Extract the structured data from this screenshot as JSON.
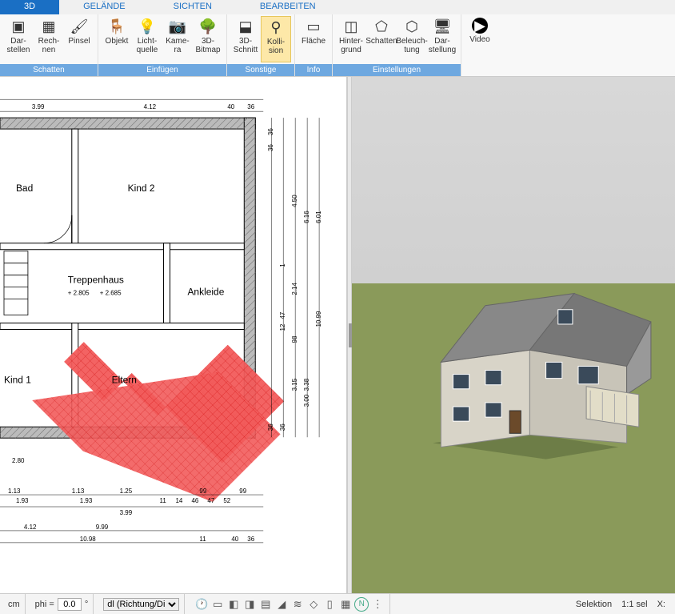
{
  "tabs": {
    "t0": "3D",
    "t1": "GELÄNDE",
    "t2": "SICHTEN",
    "t3": "BEARBEITEN"
  },
  "ribbon": {
    "schatten": {
      "label": "Schatten",
      "darstellen1": "Dar-",
      "darstellen2": "stellen",
      "rechnen1": "Rech-",
      "rechnen2": "nen",
      "pinsel": "Pinsel"
    },
    "einfuegen": {
      "label": "Einfügen",
      "objekt": "Objekt",
      "licht1": "Licht-",
      "licht2": "quelle",
      "kamera1": "Kame-",
      "kamera2": "ra",
      "bitmap1": "3D-",
      "bitmap2": "Bitmap"
    },
    "sonstige": {
      "label": "Sonstige",
      "schnitt1": "3D-",
      "schnitt2": "Schnitt",
      "kolli1": "Kolli-",
      "kolli2": "sion"
    },
    "info": {
      "label": "Info",
      "flaeche": "Fläche"
    },
    "einstellungen": {
      "label": "Einstellungen",
      "hinter1": "Hinter-",
      "hinter2": "grund",
      "schatten": "Schatten",
      "beleuch1": "Beleuch-",
      "beleuch2": "tung",
      "darst1": "Dar-",
      "darst2": "stellung"
    },
    "video": "Video"
  },
  "rooms": {
    "bad": "Bad",
    "kind2": "Kind 2",
    "treppenhaus": "Treppenhaus",
    "ankleide": "Ankleide",
    "kind1": "Kind 1",
    "eltern": "Eltern"
  },
  "elevations": {
    "e1": "+ 2.805",
    "e2": "+ 2.685"
  },
  "dims": {
    "top1": "3.99",
    "top2": "4.12",
    "top3": "40",
    "top4": "36",
    "r1": "36",
    "r2": "36",
    "r3": "4.50",
    "r4": "6.16",
    "r5": "6.01",
    "r6": "10.99",
    "r7": "1",
    "r8": "2.14",
    "r9": "47",
    "r10": "12",
    "r11": "98",
    "r12": "3.15",
    "r13": "3.38",
    "r14": "3.00",
    "r15": "36",
    "r16": "36",
    "b1": "2.80",
    "b2": "1.13",
    "b3": "1.93",
    "b4": "1.13",
    "b5": "1.93",
    "b6": "1.25",
    "b7": "3.99",
    "b8": "99",
    "b9": "99",
    "b10": "11",
    "b11": "14",
    "b12": "46",
    "b13": "47",
    "b14": "52",
    "b15": "4.12",
    "b16": "9.99",
    "b17": "10.98",
    "b18": "11",
    "b19": "40",
    "b20": "36"
  },
  "status": {
    "unit": "cm",
    "philabel": "phi =",
    "phival": "0.0",
    "phideg": "°",
    "dl": "dl (Richtung/Di",
    "selektion": "Selektion",
    "scale": "1:1 sel",
    "x": "X:"
  }
}
